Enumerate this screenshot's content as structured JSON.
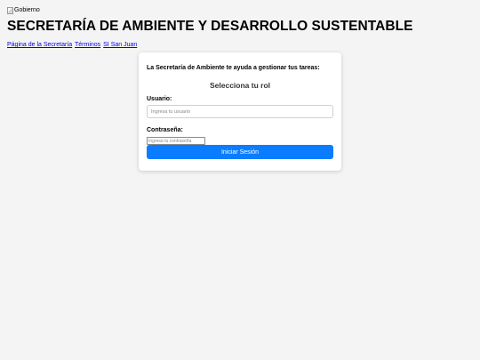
{
  "header": {
    "logo_alt": "Gobierno",
    "title": "SECRETARÍA DE AMBIENTE Y DESARROLLO SUSTENTABLE"
  },
  "nav": {
    "links": [
      "Página de la Secretaría",
      "Términos",
      "SI San Juan"
    ]
  },
  "login": {
    "intro": "La Secretaría de Ambiente te ayuda a gestionar tus tareas:",
    "role_prompt": "Selecciona tu rol",
    "user_label": "Usuario:",
    "user_placeholder": "Ingresa tu usuario",
    "pass_label": "Contraseña:",
    "pass_placeholder": "Ingresa tu contraseña",
    "submit_label": "Iniciar Sesión"
  },
  "colors": {
    "background": "#f4f4f4",
    "accent": "#0a7cff",
    "link": "#0000ee"
  }
}
